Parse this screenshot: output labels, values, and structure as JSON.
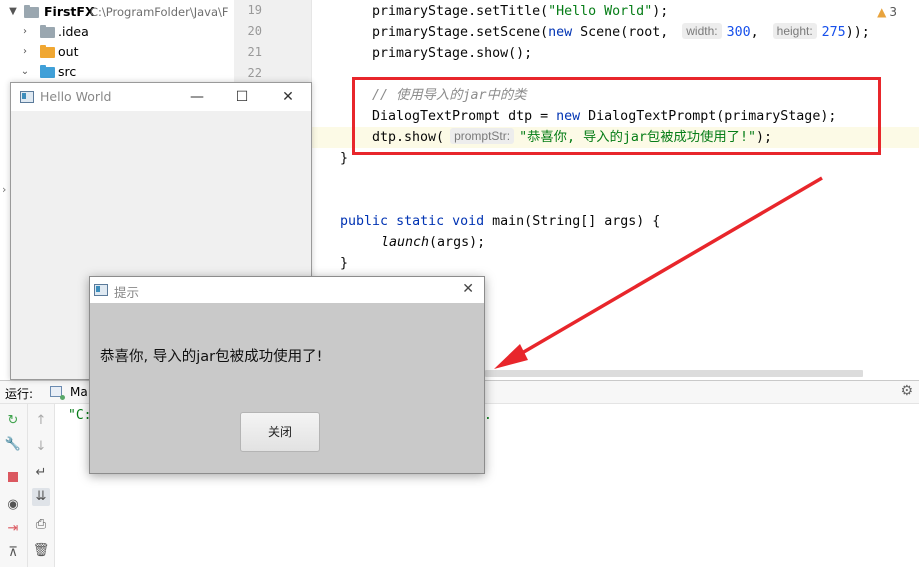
{
  "project_tree": {
    "root": {
      "name": "FirstFX",
      "path": "C:\\ProgramFolder\\Java\\F"
    },
    "items": [
      {
        "label": ".idea",
        "color": "#9aa7b0"
      },
      {
        "label": "out",
        "color": "#f0a732"
      },
      {
        "label": "src",
        "color": "#40a0d8"
      }
    ]
  },
  "editor": {
    "line_numbers": [
      "19",
      "20",
      "21",
      "22"
    ],
    "code": {
      "l19_a": "primaryStage.setTitle(",
      "l19_str": "\"Hello World\"",
      "l19_b": ");",
      "l20_a": "primaryStage.setScene(",
      "l20_kw": "new",
      "l20_b": " Scene(root, ",
      "l20_hint_w": "width:",
      "l20_num_w": "300",
      "l20_c": ", ",
      "l20_hint_h": "height:",
      "l20_num_h": "275",
      "l20_d": "));",
      "l21": "primaryStage.show();",
      "comment": "// 使用导入的jar中的类",
      "l24_a": "DialogTextPrompt dtp = ",
      "l24_kw": "new",
      "l24_b": " DialogTextPrompt(primaryStage);",
      "l25_a": "dtp.show(",
      "l25_hint": "promptStr:",
      "l25_str": "\"恭喜你, 导入的jar包被成功使用了!\"",
      "l25_b": ");",
      "l26": "}",
      "l28_kw1": "public",
      "l28_kw2": "static",
      "l28_kw3": "void",
      "l28_rest": " main(String[] args) {",
      "l29_fn": "launch",
      "l29_rest": "(args);",
      "l30": "}"
    },
    "warning_count": "3"
  },
  "hello_window": {
    "title": "Hello World",
    "minimize": "—",
    "maximize": "☐",
    "close": "✕"
  },
  "dialog": {
    "title": "提示",
    "close": "✕",
    "message": "恭喜你, 导入的jar包被成功使用了!",
    "button": "关闭"
  },
  "run_panel": {
    "label": "运行:",
    "tab": "Ma",
    "console_prefix": "\"C:",
    "console_suffix": "."
  },
  "colors": {
    "annotation_red": "#e8262b",
    "keyword": "#0033b3",
    "string": "#067d17",
    "number": "#1750eb"
  }
}
